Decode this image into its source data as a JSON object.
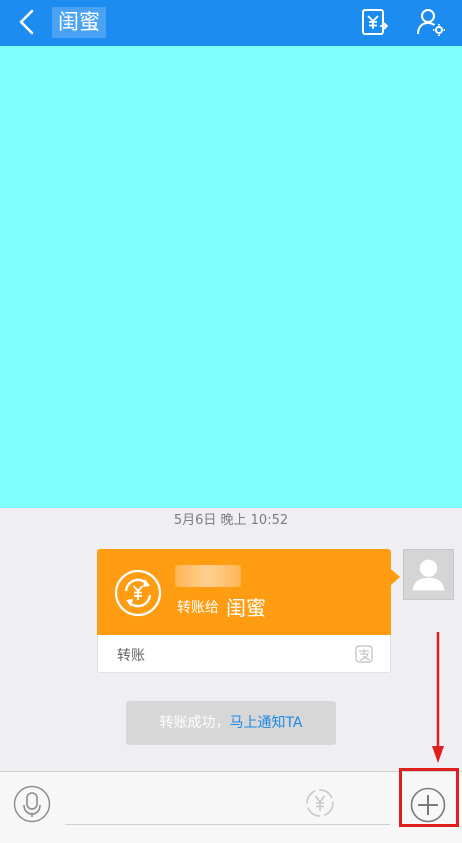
{
  "header": {
    "title": "闺蜜",
    "back_icon": "chevron-left-icon",
    "transfer_icon": "yuan-transfer-icon",
    "profile_icon": "person-settings-icon",
    "bar_color": "#1d8cf1"
  },
  "chat": {
    "timestamp": "5月6日 晚上 10:52",
    "transfer_card": {
      "label": "转账给",
      "recipient": "闺蜜",
      "type": "转账",
      "card_color": "#ff9c12"
    },
    "notice": {
      "text": "转账成功，",
      "link": "马上通知TA"
    }
  },
  "input_bar": {
    "voice_icon": "microphone-icon",
    "yuan_icon": "yuan-icon",
    "plus_icon": "plus-icon",
    "highlight_color": "#e01e1e"
  }
}
